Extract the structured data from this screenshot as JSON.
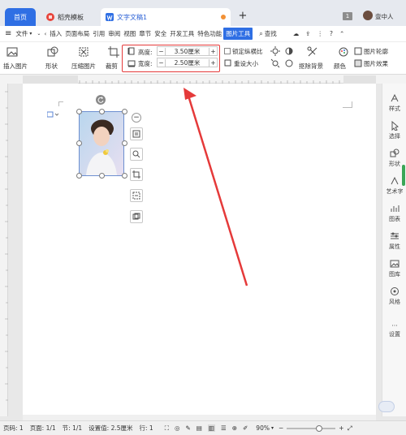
{
  "tabs": {
    "home": "首页",
    "store": "稻壳模板",
    "doc": "文字文稿1",
    "badge": "1",
    "user": "壹中人"
  },
  "menu": {
    "file": "文件",
    "items": [
      "插入",
      "页面布局",
      "引用",
      "审阅",
      "视图",
      "章节",
      "安全",
      "开发工具",
      "特色功能"
    ],
    "active": "图片工具",
    "search": "查找"
  },
  "ribbon": {
    "insert_image": "插入图片",
    "shape": "形状",
    "compress": "压缩图片",
    "crop": "裁剪",
    "height_label": "高度:",
    "height_value": "3.50厘米",
    "width_label": "宽度:",
    "width_value": "2.50厘米",
    "lock_ratio": "锁定纵横比",
    "reset_size": "重设大小",
    "remove_bg": "抠除背景",
    "color": "颜色",
    "outline": "图片轮廓",
    "effect": "图片效果"
  },
  "right_panel": [
    "样式",
    "选择",
    "形状",
    "艺术字",
    "图表",
    "属性",
    "图库",
    "风格",
    "设置"
  ],
  "status": {
    "page_num": "页码: 1",
    "page": "页面: 1/1",
    "section": "节: 1/1",
    "setting": "设置值: 2.5厘米",
    "row": "行: 1",
    "zoom": "90%"
  },
  "colors": {
    "accent": "#2f6fe4",
    "highlight": "#e53a3a"
  }
}
